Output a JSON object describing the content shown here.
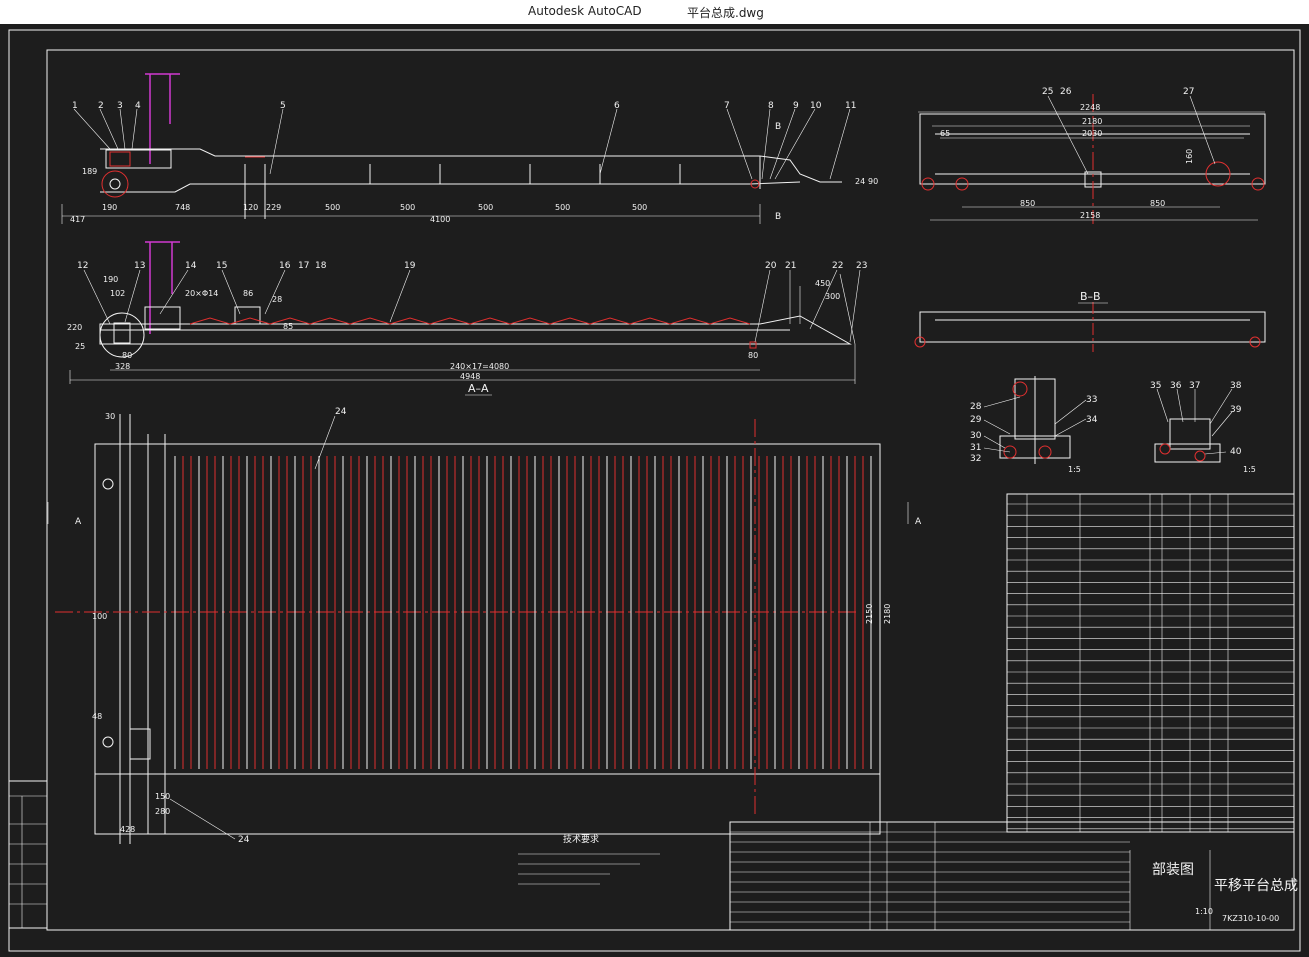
{
  "window": {
    "app_name": "Autodesk AutoCAD",
    "document_name": "平台总成.dwg"
  },
  "colors": {
    "canvas_bg": "#1d1d1d",
    "line_white": "#f2f2f2",
    "line_red": "#e03030",
    "line_magenta": "#d03ad0"
  },
  "drawing": {
    "sheet_name": "部装图",
    "assembly_name": "平移平台总成",
    "drawing_number": "7KZ310-10-00",
    "scale": "1:10",
    "view_section_aa": "A–A",
    "view_section_bb": "B–B",
    "section_mark_a": "A",
    "section_mark_b": "B",
    "detail_scale": "1:5",
    "tech_req_title": "技术要求",
    "leader_numbers_top": [
      "1",
      "2",
      "3",
      "4",
      "5",
      "6",
      "7",
      "8",
      "9",
      "10",
      "11"
    ],
    "leader_numbers_mid": [
      "12",
      "13",
      "14",
      "15",
      "16",
      "17",
      "18",
      "19",
      "20",
      "21",
      "22",
      "23"
    ],
    "leader_numbers_plan": [
      "24",
      "24"
    ],
    "leader_numbers_side": [
      "25",
      "26",
      "27"
    ],
    "leader_numbers_detail": [
      "28",
      "29",
      "30",
      "31",
      "32",
      "33",
      "34",
      "35",
      "36",
      "37",
      "38",
      "39",
      "40"
    ],
    "dims_top": [
      "417",
      "190",
      "748",
      "120",
      "229",
      "500",
      "500",
      "500",
      "500",
      "500",
      "4100",
      "189",
      "24",
      "90"
    ],
    "dims_mid": [
      "190",
      "102",
      "20×Φ14",
      "86",
      "28",
      "85",
      "220",
      "25",
      "80",
      "328",
      "240×17=4080",
      "4948",
      "450",
      "300",
      "80"
    ],
    "dims_plan": [
      "30",
      "100",
      "48",
      "150",
      "280",
      "428",
      "2150",
      "2180"
    ],
    "dims_side": [
      "2248",
      "2180",
      "2030",
      "65",
      "160",
      "850",
      "850",
      "2158"
    ]
  }
}
